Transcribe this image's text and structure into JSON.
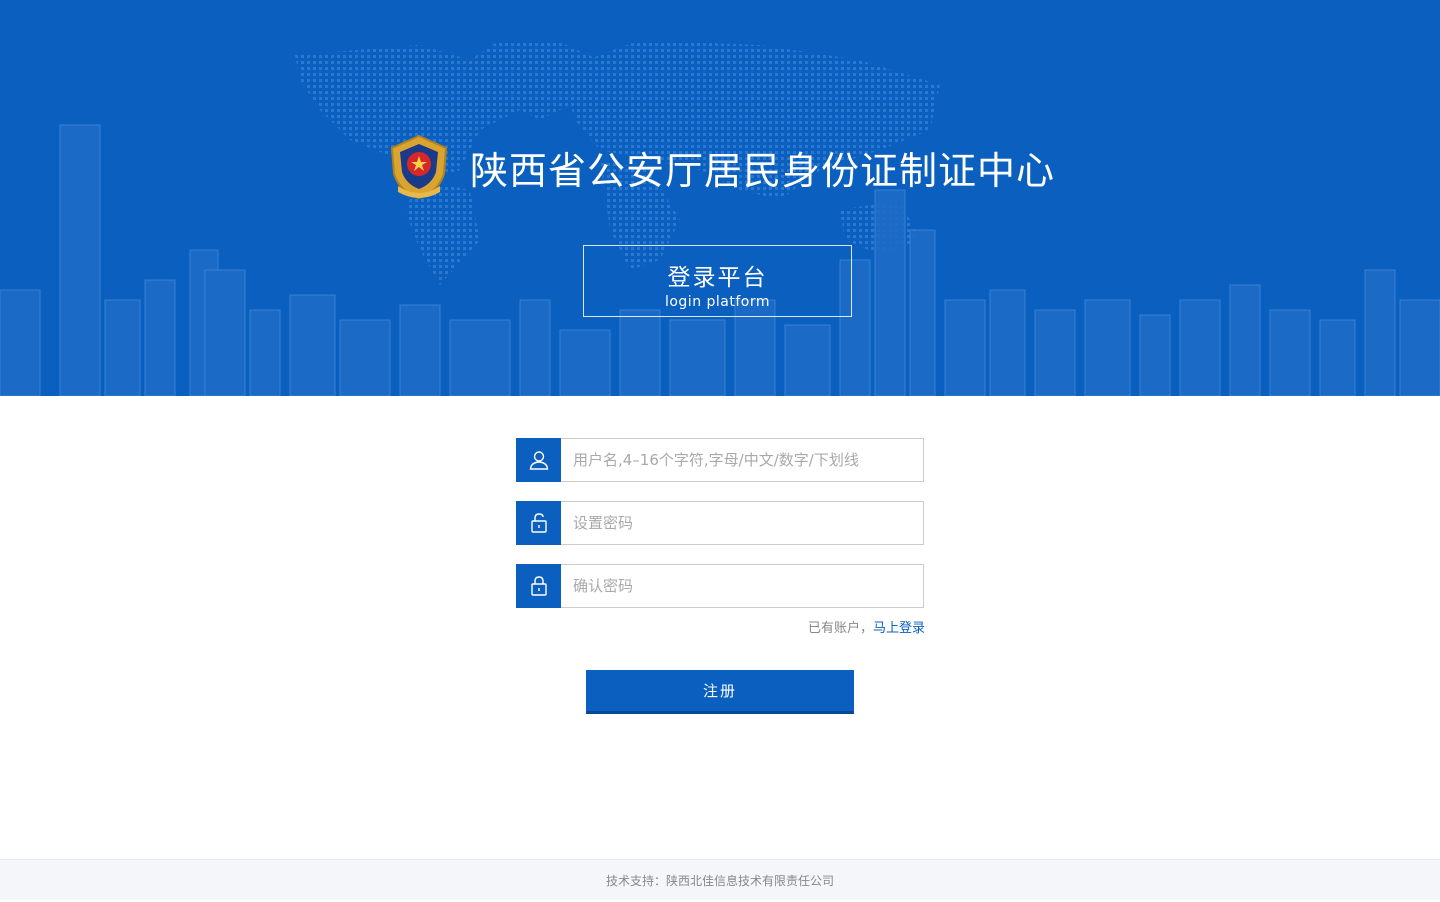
{
  "header": {
    "title": "陕西省公安厅居民身份证制证中心",
    "platform_cn": "登录平台",
    "platform_en": "login platform"
  },
  "form": {
    "username_placeholder": "用户名,4–16个字符,字母/中文/数字/下划线",
    "password_placeholder": "设置密码",
    "confirm_placeholder": "确认密码",
    "has_account_text": "已有账户，",
    "login_link": "马上登录",
    "register_label": "注册"
  },
  "footer": {
    "text": "技术支持：陕西北佳信息技术有限责任公司"
  },
  "icons": {
    "emblem": "police-emblem-icon",
    "user": "user-icon",
    "password": "unlock-icon",
    "confirm": "lock-icon"
  },
  "colors": {
    "brand_blue": "#0a5fbf",
    "footer_bg": "#f4f6f9"
  }
}
